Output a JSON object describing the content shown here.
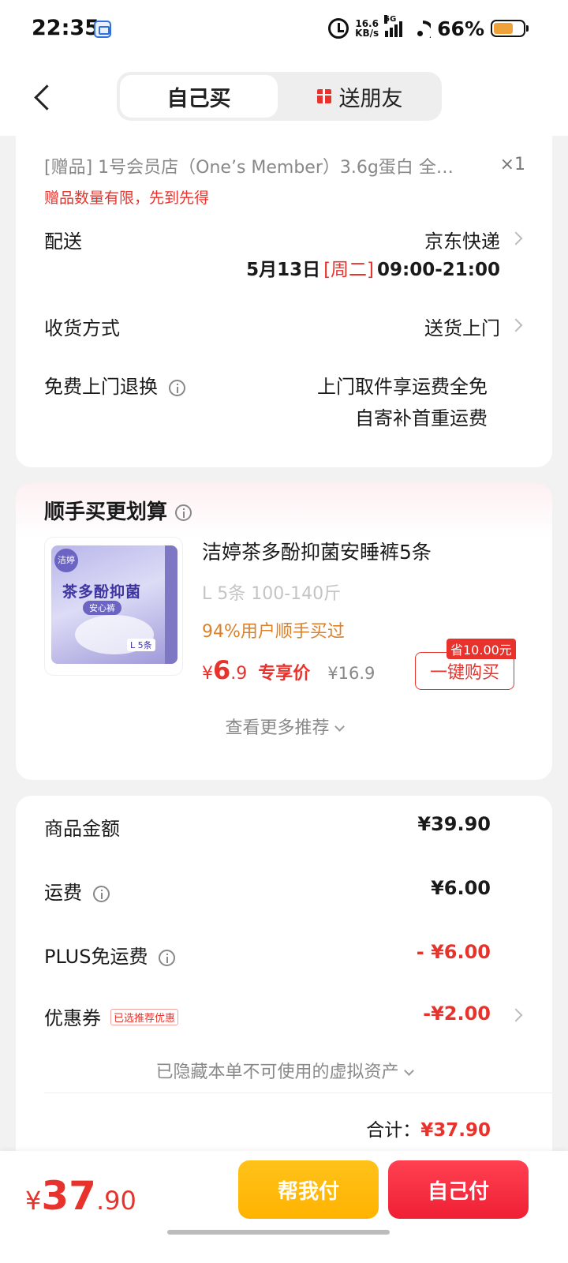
{
  "status_bar": {
    "time": "22:35",
    "net_speed_value": "16.6",
    "net_speed_unit": "KB/s",
    "network": "5G",
    "battery": "66%",
    "battery_level": 0.66,
    "icons": [
      "app-notification-icon",
      "alarm-icon",
      "signal-icon",
      "wifi-icon",
      "battery-icon"
    ]
  },
  "header": {
    "back_icon": "chevron-left-icon",
    "tabs": [
      {
        "label": "自己买",
        "active": true
      },
      {
        "label": "送朋友",
        "icon": "gift-icon",
        "active": false
      }
    ]
  },
  "order": {
    "gift_line": "[赠品]  1号会员店（One’s Member）3.6g蛋白 全…",
    "gift_qty": "×1",
    "gift_note": "赠品数量有限，先到先得",
    "delivery_label": "配送",
    "delivery_carrier": "京东快递",
    "delivery_date": "5月13日",
    "delivery_weekday": "[周二]",
    "delivery_window": "09:00-21:00",
    "receive_label": "收货方式",
    "receive_value": "送货上门",
    "return_label": "免费上门退换",
    "return_line1": "上门取件享运费全免",
    "return_line2": "自寄补首重运费"
  },
  "recommend": {
    "title": "顺手买更划算",
    "product_name": "洁婷茶多酚抑菌安睡裤5条",
    "product_spec": "L 5条 100-140斤",
    "bought_text": "94%用户顺手买过",
    "price_yen": "¥",
    "price_int": "6",
    "price_dec": ".9",
    "price_tag": "专享价",
    "original_price": "¥16.9",
    "save_tag": "省10.00元",
    "buy_label": "一键购买",
    "more_label": "查看更多推荐",
    "pack": {
      "brand": "洁婷",
      "title": "茶多酚抑菌",
      "sub": "安心裤",
      "size": "L 5条"
    }
  },
  "summary": {
    "goods_label": "商品金额",
    "goods_value": "¥39.90",
    "shipping_label": "运费",
    "shipping_value": "¥6.00",
    "plus_label": "PLUS免运费",
    "plus_value": "- ¥6.00",
    "coupon_label": "优惠券",
    "coupon_badge": "已选推荐优惠",
    "coupon_value": "-¥2.00",
    "hidden_assets": "已隐藏本单不可使用的虚拟资产",
    "total_label": "合计：",
    "total_value": "¥37.90"
  },
  "bottom": {
    "price_yen": "¥",
    "price_int": "37",
    "price_dec": ".90",
    "pay_help_label": "帮我付",
    "pay_self_label": "自己付"
  },
  "colors": {
    "accent_red": "#e8332d",
    "orange_text": "#d9822b",
    "yellow_button": "#ffb300",
    "red_button": "#ef1f34"
  }
}
